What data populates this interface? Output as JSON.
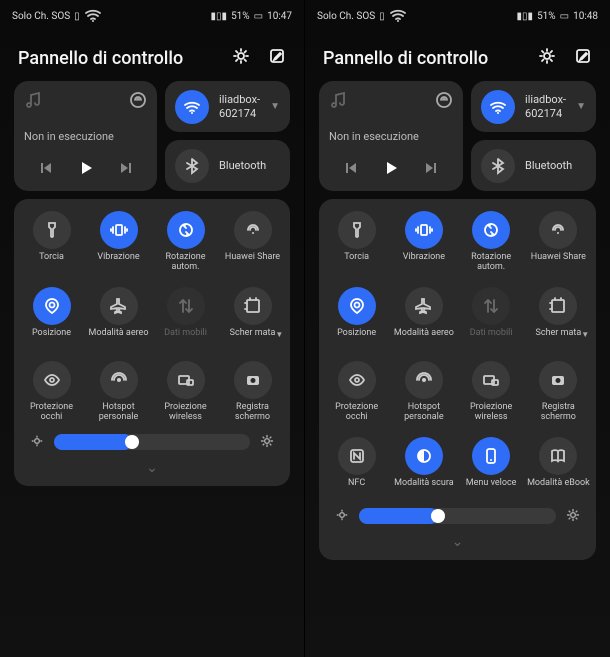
{
  "panels": [
    {
      "status": {
        "left": "Solo Ch. SOS",
        "vibIcon": true,
        "battery": "51%",
        "time": "10:47"
      },
      "title": "Pannello di controllo",
      "media": {
        "status": "Non in esecuzione"
      },
      "wifi": {
        "ssid": "iliadbox-602174",
        "active": true
      },
      "bluetooth": {
        "label": "Bluetooth",
        "active": false
      },
      "toggles": [
        {
          "id": "torch",
          "label": "Torcia",
          "active": false
        },
        {
          "id": "vibration",
          "label": "Vibrazione",
          "active": true
        },
        {
          "id": "autorotate",
          "label": "Rotazione autom.",
          "active": true
        },
        {
          "id": "hwshare",
          "label": "Huawei Share",
          "active": false
        },
        {
          "id": "location",
          "label": "Posizione",
          "active": true
        },
        {
          "id": "airplane",
          "label": "Modalità aereo",
          "active": false
        },
        {
          "id": "mobiledata",
          "label": "Dati mobili",
          "active": false,
          "dim": true
        },
        {
          "id": "screenshot",
          "label": "Scher mata",
          "active": false,
          "caret": true
        },
        {
          "id": "eyecomfort",
          "label": "Protezione occhi",
          "active": false
        },
        {
          "id": "hotspot",
          "label": "Hotspot personale",
          "active": false
        },
        {
          "id": "wirelessproj",
          "label": "Proiezione wireless",
          "active": false
        },
        {
          "id": "screenrec",
          "label": "Registra schermo",
          "active": false
        }
      ],
      "brightness": 40
    },
    {
      "status": {
        "left": "Solo Ch. SOS",
        "vibIcon": true,
        "battery": "51%",
        "time": "10:48"
      },
      "title": "Pannello di controllo",
      "media": {
        "status": "Non in esecuzione"
      },
      "wifi": {
        "ssid": "iliadbox-602174",
        "active": true
      },
      "bluetooth": {
        "label": "Bluetooth",
        "active": false
      },
      "toggles": [
        {
          "id": "torch",
          "label": "Torcia",
          "active": false
        },
        {
          "id": "vibration",
          "label": "Vibrazione",
          "active": true
        },
        {
          "id": "autorotate",
          "label": "Rotazione autom.",
          "active": true
        },
        {
          "id": "hwshare",
          "label": "Huawei Share",
          "active": false
        },
        {
          "id": "location",
          "label": "Posizione",
          "active": true
        },
        {
          "id": "airplane",
          "label": "Modalità aereo",
          "active": false
        },
        {
          "id": "mobiledata",
          "label": "Dati mobili",
          "active": false,
          "dim": true
        },
        {
          "id": "screenshot",
          "label": "Scher mata",
          "active": false,
          "caret": true
        },
        {
          "id": "eyecomfort",
          "label": "Protezione occhi",
          "active": false
        },
        {
          "id": "hotspot",
          "label": "Hotspot personale",
          "active": false
        },
        {
          "id": "wirelessproj",
          "label": "Proiezione wireless",
          "active": false
        },
        {
          "id": "screenrec",
          "label": "Registra schermo",
          "active": false
        },
        {
          "id": "nfc",
          "label": "NFC",
          "active": false
        },
        {
          "id": "darkmode",
          "label": "Modalità scura",
          "active": true
        },
        {
          "id": "quickmenu",
          "label": "Menu veloce",
          "active": true
        },
        {
          "id": "ebook",
          "label": "Modalità eBook",
          "active": false
        }
      ],
      "brightness": 40
    }
  ]
}
